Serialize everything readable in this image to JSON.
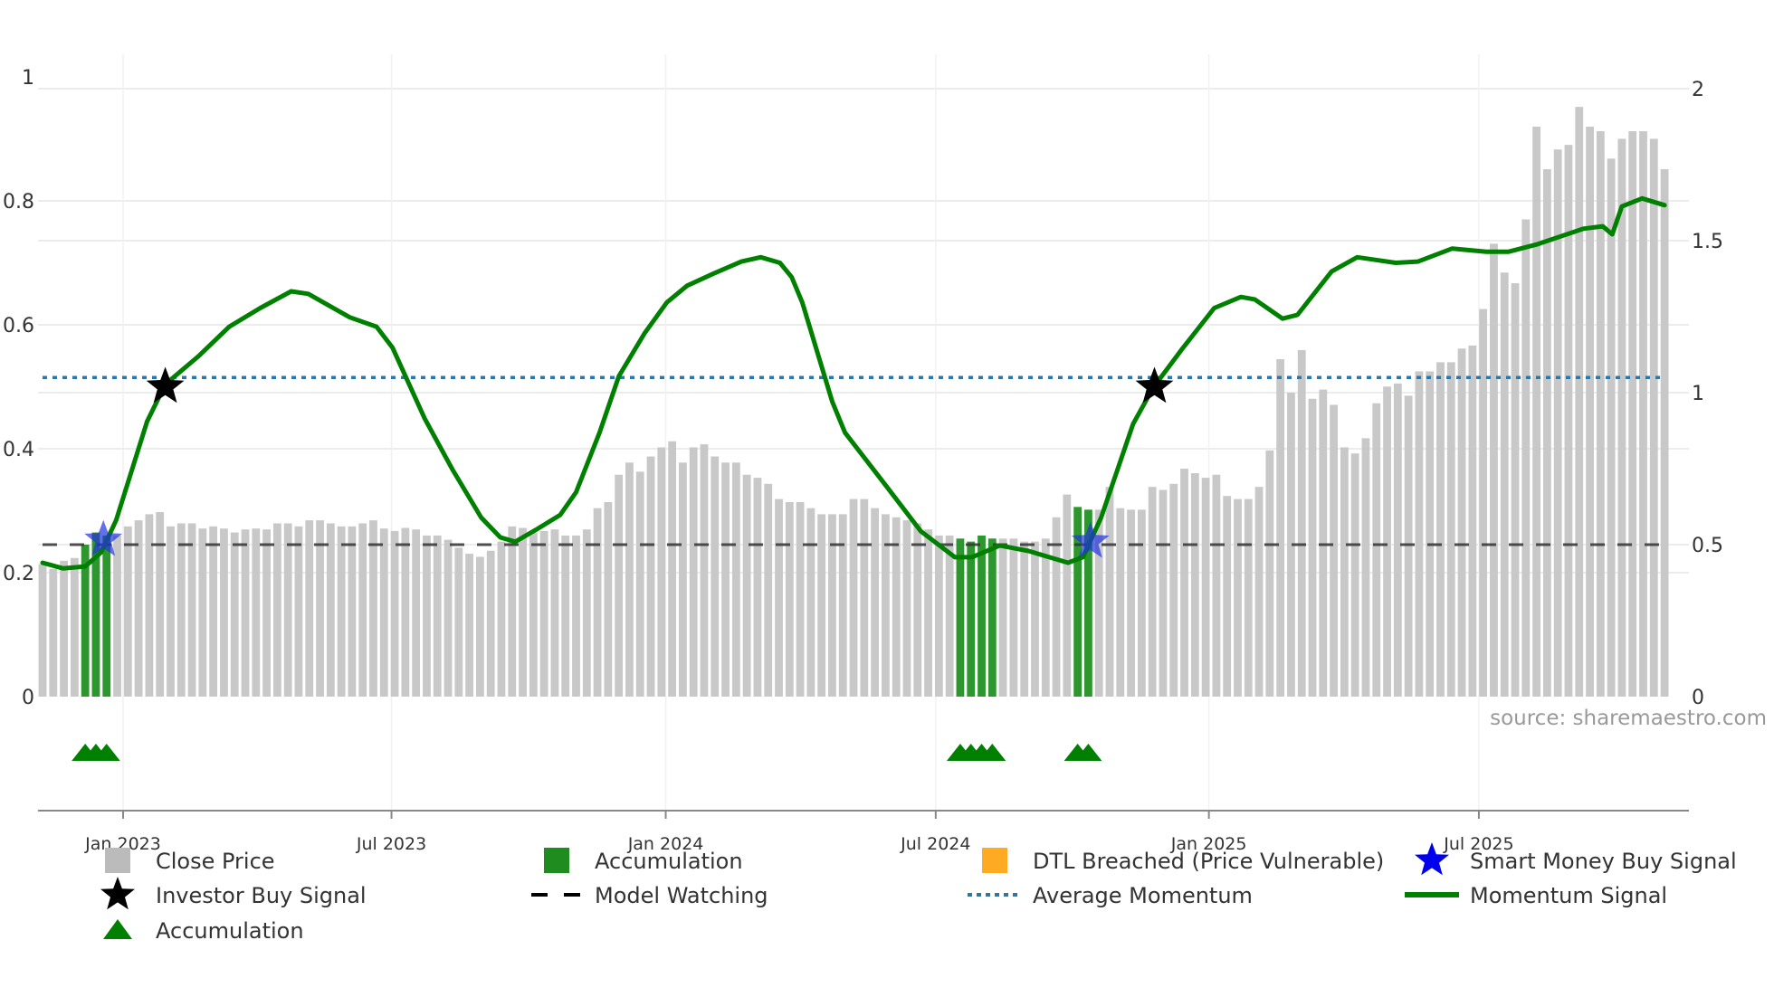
{
  "chart_data": {
    "type": "bar",
    "title": "",
    "source": "source: sharemaestro.com",
    "x_unit": "week index (weekly bars)",
    "xlim": [
      -0.5,
      153
    ],
    "y_left": {
      "ylim": [
        0,
        1
      ],
      "ticks": [
        0,
        0.2,
        0.4,
        0.6,
        0.8,
        1
      ],
      "tick_labels": [
        "0",
        "0.2",
        "0.4",
        "0.6",
        "0.8",
        "1"
      ]
    },
    "y_right": {
      "ylim": [
        0,
        2
      ],
      "ticks": [
        0,
        0.5,
        1,
        1.5,
        2
      ],
      "tick_labels": [
        "0",
        "0.5",
        "1",
        "1.5",
        "2"
      ]
    },
    "x_ticks": [
      {
        "label": "Jan 2023",
        "week": 7.55
      },
      {
        "label": "Jul 2023",
        "week": 32.7
      },
      {
        "label": "Jan 2024",
        "week": 58.4
      },
      {
        "label": "Jul 2024",
        "week": 83.7
      },
      {
        "label": "Jan 2025",
        "week": 109.3
      },
      {
        "label": "Jul 2025",
        "week": 134.6
      }
    ],
    "close_price": [
      0.436,
      0.42,
      0.447,
      0.456,
      0.5,
      0.54,
      0.53,
      0.53,
      0.56,
      0.58,
      0.6,
      0.607,
      0.56,
      0.57,
      0.57,
      0.553,
      0.56,
      0.553,
      0.54,
      0.55,
      0.553,
      0.55,
      0.57,
      0.57,
      0.56,
      0.58,
      0.58,
      0.57,
      0.56,
      0.56,
      0.57,
      0.58,
      0.553,
      0.545,
      0.555,
      0.55,
      0.53,
      0.53,
      0.516,
      0.49,
      0.47,
      0.46,
      0.48,
      0.51,
      0.56,
      0.555,
      0.54,
      0.545,
      0.55,
      0.53,
      0.53,
      0.55,
      0.62,
      0.64,
      0.73,
      0.77,
      0.74,
      0.79,
      0.82,
      0.84,
      0.77,
      0.82,
      0.83,
      0.79,
      0.77,
      0.77,
      0.73,
      0.72,
      0.7,
      0.65,
      0.64,
      0.64,
      0.62,
      0.6,
      0.6,
      0.6,
      0.65,
      0.65,
      0.62,
      0.6,
      0.59,
      0.58,
      0.57,
      0.55,
      0.53,
      0.53,
      0.52,
      0.51,
      0.53,
      0.52,
      0.52,
      0.52,
      0.51,
      0.51,
      0.52,
      0.59,
      0.665,
      0.624,
      0.615,
      0.615,
      0.69,
      0.62,
      0.615,
      0.615,
      0.69,
      0.68,
      0.7,
      0.75,
      0.735,
      0.72,
      0.73,
      0.66,
      0.65,
      0.65,
      0.69,
      0.81,
      1.11,
      1.0,
      1.14,
      0.98,
      1.01,
      0.96,
      0.82,
      0.8,
      0.85,
      0.965,
      1.02,
      1.03,
      0.99,
      1.07,
      1.07,
      1.1,
      1.1,
      1.145,
      1.155,
      1.275,
      1.49,
      1.395,
      1.36,
      1.57,
      1.875,
      1.735,
      1.8,
      1.815,
      1.94,
      1.875,
      1.86,
      1.77,
      1.835,
      1.86,
      1.86,
      1.835,
      1.735
    ],
    "accumulation_weeks": [
      4,
      5,
      6,
      86,
      87,
      88,
      89,
      97,
      98
    ],
    "momentum_signal": [
      [
        0,
        0.216
      ],
      [
        1.9,
        0.207
      ],
      [
        4,
        0.21
      ],
      [
        5.5,
        0.233
      ],
      [
        6.9,
        0.285
      ],
      [
        9.8,
        0.444
      ],
      [
        11.5,
        0.504
      ],
      [
        14.6,
        0.549
      ],
      [
        17.5,
        0.597
      ],
      [
        20.4,
        0.627
      ],
      [
        23.3,
        0.654
      ],
      [
        24.9,
        0.65
      ],
      [
        28.8,
        0.612
      ],
      [
        31.3,
        0.597
      ],
      [
        32.8,
        0.563
      ],
      [
        35.8,
        0.449
      ],
      [
        38.4,
        0.367
      ],
      [
        41.1,
        0.289
      ],
      [
        42.9,
        0.257
      ],
      [
        44.3,
        0.25
      ],
      [
        46.4,
        0.271
      ],
      [
        48.5,
        0.293
      ],
      [
        50,
        0.33
      ],
      [
        52.2,
        0.426
      ],
      [
        54,
        0.517
      ],
      [
        56.4,
        0.586
      ],
      [
        58.5,
        0.636
      ],
      [
        60.4,
        0.663
      ],
      [
        62.8,
        0.682
      ],
      [
        65.5,
        0.702
      ],
      [
        67.3,
        0.709
      ],
      [
        69.1,
        0.7
      ],
      [
        70.2,
        0.677
      ],
      [
        71.2,
        0.636
      ],
      [
        74,
        0.476
      ],
      [
        75.2,
        0.426
      ],
      [
        79.1,
        0.339
      ],
      [
        82.3,
        0.267
      ],
      [
        85.5,
        0.225
      ],
      [
        87.1,
        0.225
      ],
      [
        89.7,
        0.244
      ],
      [
        92.4,
        0.235
      ],
      [
        96.1,
        0.216
      ],
      [
        97.5,
        0.225
      ],
      [
        99.2,
        0.289
      ],
      [
        102.2,
        0.44
      ],
      [
        104.1,
        0.499
      ],
      [
        106.7,
        0.559
      ],
      [
        109.8,
        0.627
      ],
      [
        112.3,
        0.645
      ],
      [
        113.6,
        0.641
      ],
      [
        116.2,
        0.61
      ],
      [
        117.6,
        0.616
      ],
      [
        120.8,
        0.686
      ],
      [
        123.2,
        0.709
      ],
      [
        126.8,
        0.7
      ],
      [
        128.9,
        0.702
      ],
      [
        132.1,
        0.723
      ],
      [
        135.3,
        0.718
      ],
      [
        137.4,
        0.718
      ],
      [
        140.1,
        0.73
      ],
      [
        144.4,
        0.755
      ],
      [
        146.2,
        0.759
      ],
      [
        147.1,
        0.746
      ],
      [
        148,
        0.791
      ],
      [
        149.9,
        0.804
      ],
      [
        152,
        0.793
      ]
    ],
    "average_momentum": 0.515,
    "model_watching_price": 0.5,
    "investor_buy_signals": [
      [
        11.5,
        0.5
      ],
      [
        104.2,
        0.5
      ]
    ],
    "smart_money_buy_signals": [
      [
        5.7,
        0.253
      ],
      [
        98.2,
        0.25
      ]
    ],
    "legend": {
      "placement": "bottom",
      "items": [
        {
          "label": "Close Price",
          "icon": "square",
          "color": "#bbbbbb"
        },
        {
          "label": "Accumulation",
          "icon": "square",
          "color": "#1e8c1e"
        },
        {
          "label": "DTL Breached (Price Vulnerable)",
          "icon": "square",
          "color": "#ffaa22"
        },
        {
          "label": "Smart Money Buy Signal",
          "icon": "star",
          "color": "#0000ee"
        },
        {
          "label": "Investor Buy Signal",
          "icon": "star",
          "color": "#000000"
        },
        {
          "label": "Model Watching",
          "icon": "dash",
          "color": "#000000"
        },
        {
          "label": "Average Momentum",
          "icon": "dot",
          "color": "#2b77a8"
        },
        {
          "label": "Momentum Signal",
          "icon": "line",
          "color": "#008000"
        },
        {
          "label": "Accumulation",
          "icon": "triangle",
          "color": "#008000"
        }
      ]
    },
    "colors": {
      "price": "#c8c8c8",
      "accumulation_bar": "#2e962e",
      "momentum": "#008000",
      "avg": "#2b77a8",
      "grid": "#ececec",
      "axis": "#888888"
    }
  }
}
